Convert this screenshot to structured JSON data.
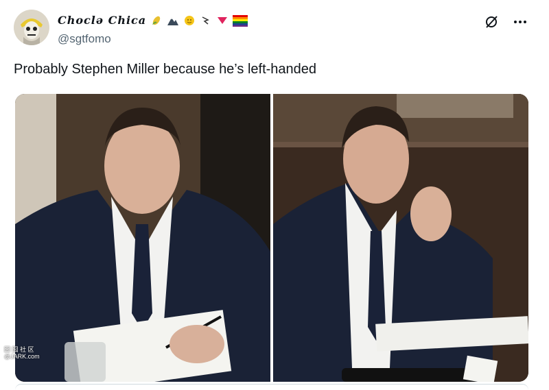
{
  "post": {
    "display_name": "Choclə Chica",
    "name_icons": [
      "corn-emoji",
      "mountain-emoji",
      "sun-emoji",
      "flag-emoji",
      "triangle-emoji",
      "rainbow-flag-emoji"
    ],
    "handle": "@sgtfomo",
    "text": "Probably Stephen Miller because he’s left-handed",
    "actions": [
      "grok-icon",
      "more-icon"
    ]
  },
  "media": {
    "images": [
      {
        "description_icon": "photo-man-writing"
      },
      {
        "description_icon": "photo-man-thinking"
      }
    ]
  },
  "watermark": {
    "line1": "囧 囧 社 区",
    "line2": "@JARK.com"
  },
  "colors": {
    "text": "#0f1419",
    "secondary": "#536471",
    "border": "#cfd9de"
  }
}
